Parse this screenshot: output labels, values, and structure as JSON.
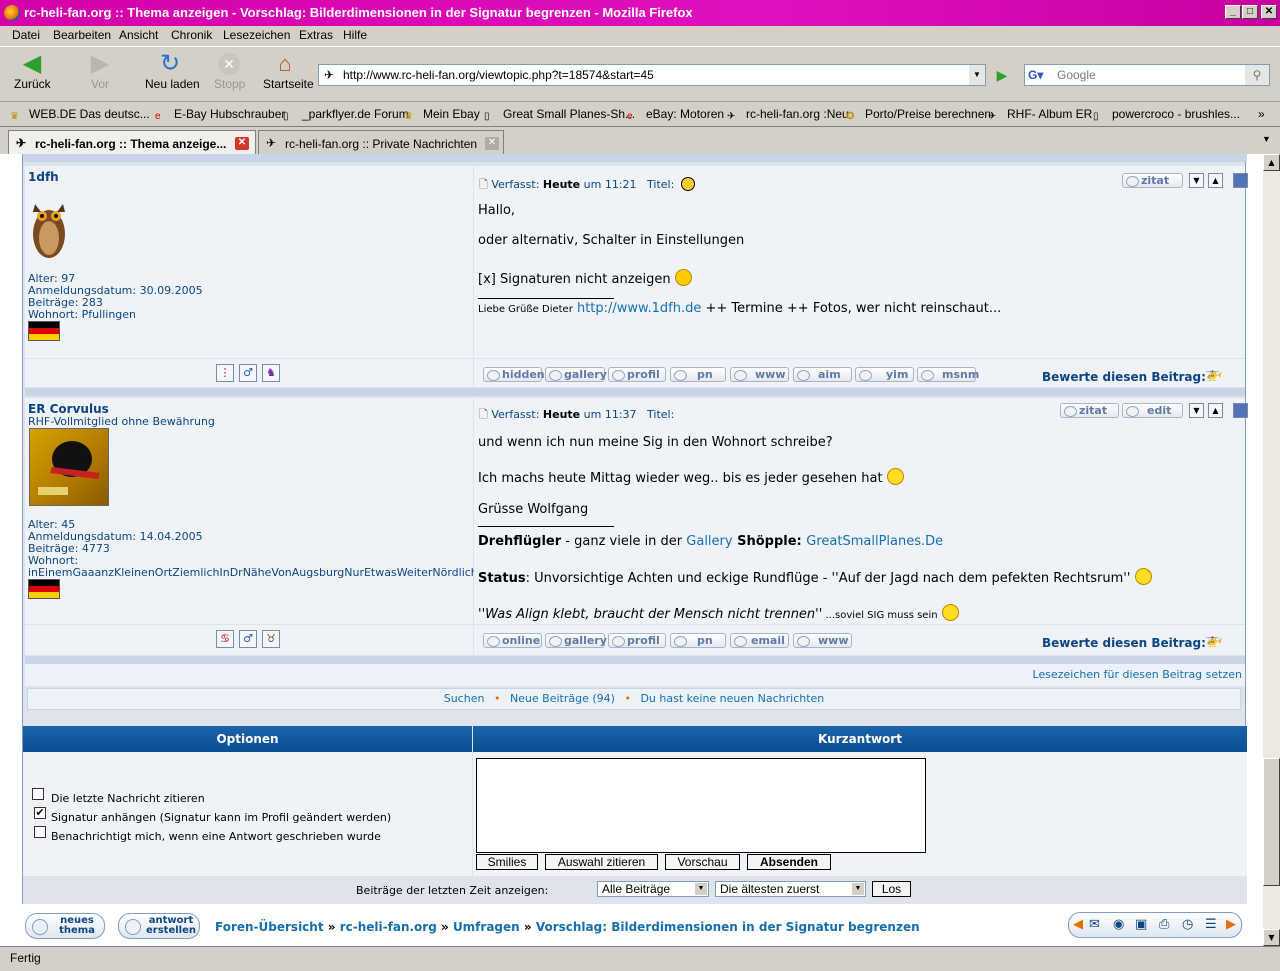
{
  "window": {
    "title": "rc-heli-fan.org :: Thema anzeigen - Vorschlag: Bilderdimensionen in der Signatur begrenzen - Mozilla Firefox"
  },
  "menu": [
    "Datei",
    "Bearbeiten",
    "Ansicht",
    "Chronik",
    "Lesezeichen",
    "Extras",
    "Hilfe"
  ],
  "nav": {
    "back": "Zurück",
    "forward": "Vor",
    "reload": "Neu laden",
    "stop": "Stopp",
    "home": "Startseite",
    "url": "http://www.rc-heli-fan.org/viewtopic.php?t=18574&start=45",
    "search_placeholder": "Google"
  },
  "bookmarks": [
    "WEB.DE Das deutsc...",
    "E-Bay Hubschrauber",
    "_parkflyer.de Forum",
    "Mein Ebay",
    "Great Small Planes-Sh...",
    "eBay: Motoren",
    "rc-heli-fan.org :Neu",
    "Porto/Preise berechnen",
    "RHF- Album ER",
    "powercroco - brushles..."
  ],
  "tabs": [
    {
      "label": "rc-heli-fan.org :: Thema anzeige..."
    },
    {
      "label": "rc-heli-fan.org :: Private Nachrichten"
    }
  ],
  "posts": [
    {
      "username": "1dfh",
      "rank": "",
      "info": [
        "Alter: 97",
        "Anmeldungsdatum: 30.09.2005",
        "Beiträge: 283",
        "Wohnort: Pfullingen"
      ],
      "header": {
        "label": "Verfasst:",
        "day": "Heute",
        "time": "um 11:21",
        "title_label": "Titel:"
      },
      "lines": [
        "Hallo,",
        "oder alternativ, Schalter in Einstellungen",
        "[x] Signaturen nicht anzeigen"
      ],
      "signature": {
        "greeting": "Liebe Grüße Dieter",
        "link": "http://www.1dfh.de",
        "rest": "++ Termine ++ Fotos, wer nicht reinschaut..."
      },
      "actions": [
        "zitat"
      ],
      "buttons": [
        "hidden",
        "gallery",
        "profil",
        "pn",
        "www",
        "aim",
        "yim",
        "msnm"
      ]
    },
    {
      "username": "ER Corvulus",
      "rank": "RHF-Vollmitglied ohne Bewährung",
      "info": [
        "Alter: 45",
        "Anmeldungsdatum: 14.04.2005",
        "Beiträge: 4773",
        "Wohnort:",
        "inEinemGaaanzKleinenOrtZiemlichInDrNäheVonAugsburgNurEtwasWeiterNördlich"
      ],
      "header": {
        "label": "Verfasst:",
        "day": "Heute",
        "time": "um 11:37",
        "title_label": "Titel:"
      },
      "lines": [
        "und wenn ich nun meine Sig in den Wohnort schreibe?",
        "Ich machs heute Mittag wieder weg.. bis es jeder gesehen hat",
        "Grüsse Wolfgang"
      ],
      "signature": {
        "l1_bold": "Drehflügler",
        "l1_text": " - ganz viele in der ",
        "l1_link1": "Gallery",
        "l1_bold2": " Shöpple: ",
        "l1_link2": "GreatSmallPlanes.De",
        "l2_bold": "Status",
        "l2_text": ": Unvorsichtige Achten und eckige Rundflüge - ''Auf der Jagd nach dem pefekten Rechtsrum''",
        "l3_italic": "''Was Align klebt, braucht der Mensch nicht trennen''",
        "l3_small": " ...soviel SIG muss sein"
      },
      "actions": [
        "zitat",
        "edit"
      ],
      "buttons": [
        "online",
        "gallery",
        "profil",
        "pn",
        "email",
        "www"
      ]
    }
  ],
  "rate_label": "Bewerte diesen Beitrag:",
  "bookmark_link": "Lesezeichen für diesen Beitrag setzen",
  "footer_links": {
    "search": "Suchen",
    "new": "Neue Beiträge (94)",
    "messages": "Du hast keine neuen Nachrichten"
  },
  "options": {
    "title": "Optionen",
    "items": [
      {
        "label": "Die letzte Nachricht zitieren",
        "checked": ""
      },
      {
        "label": "Signatur anhängen (Signatur kann im Profil geändert werden)",
        "checked": "✔"
      },
      {
        "label": "Benachrichtigt mich, wenn eine Antwort geschrieben wurde",
        "checked": ""
      }
    ]
  },
  "quickreply": {
    "title": "Kurzantwort",
    "buttons": [
      "Smilies",
      "Auswahl zitieren",
      "Vorschau",
      "Absenden"
    ]
  },
  "filter": {
    "label": "Beiträge der letzten Zeit anzeigen:",
    "sel1": "Alle Beiträge",
    "sel2": "Die ältesten zuerst",
    "go": "Los"
  },
  "bottom": {
    "new_topic": [
      "neues",
      "thema"
    ],
    "reply": [
      "antwort",
      "erstellen"
    ],
    "crumbs": [
      "Foren-Übersicht",
      "rc-heli-fan.org",
      "Umfragen",
      "Vorschlag: Bilderdimensionen in der Signatur begrenzen"
    ]
  },
  "status": "Fertig",
  "colors": {
    "title_bar": "#d400a8",
    "forum_blue": "#0c4582",
    "link": "#156faf",
    "header_bar": "#0a4d93"
  }
}
